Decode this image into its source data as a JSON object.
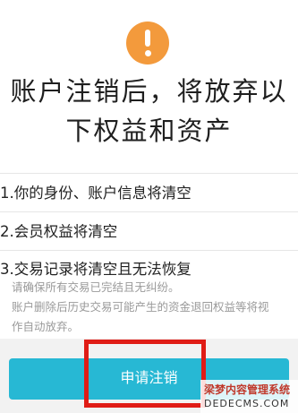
{
  "warning_icon": "exclamation-circle-icon",
  "headline": {
    "line1": "账户注销后，将放弃以",
    "line2": "下权益和资产"
  },
  "items": [
    {
      "label": "1.你的身份、账户信息将清空"
    },
    {
      "label": "2.会员权益将清空"
    },
    {
      "label": "3.交易记录将清空且无法恢复"
    }
  ],
  "notes": {
    "line1": "请确保所有交易已完结且无纠纷。",
    "line2": "账户删除后历史交易可能产生的资金退回权益等将视",
    "line3": "作自动放弃。"
  },
  "apply_button": {
    "label": "申请注销"
  },
  "watermark": {
    "cn": "梁梦内容管理系统",
    "en": "DEDECMS.COM"
  },
  "colors": {
    "accent": "#27b8d4",
    "warning": "#f39a3c",
    "highlight": "#e01c16"
  }
}
